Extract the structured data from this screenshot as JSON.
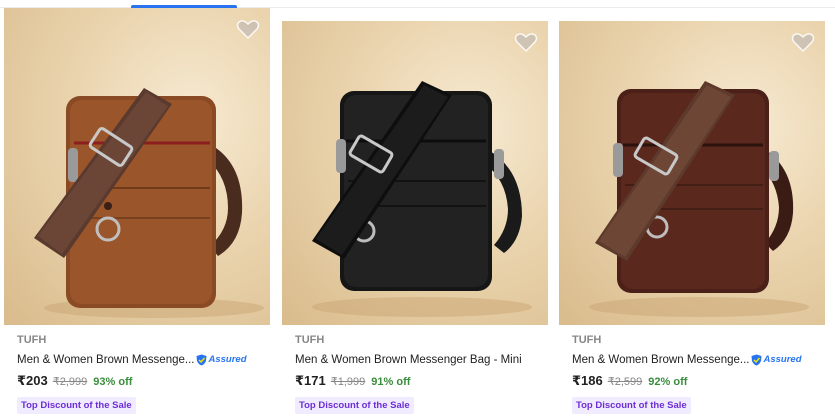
{
  "colors": {
    "accent": "#2874f0",
    "discount": "#388e3c",
    "badge_bg": "#f1ebff",
    "badge_text": "#6c2fd6",
    "muted": "#878787"
  },
  "products": [
    {
      "brand": "TUFH",
      "title": "Men & Women Brown Messenge...",
      "assured": "Assured",
      "price": "₹203",
      "mrp": "₹2,999",
      "discount": "93% off",
      "badge": "Top Discount of the Sale",
      "bag_color": "tan-brown"
    },
    {
      "brand": "TUFH",
      "title": "Men & Women Brown Messenger Bag - Mini",
      "assured": "",
      "price": "₹171",
      "mrp": "₹1,999",
      "discount": "91% off",
      "badge": "Top Discount of the Sale",
      "bag_color": "black"
    },
    {
      "brand": "TUFH",
      "title": "Men & Women Brown Messenge...",
      "assured": "Assured",
      "price": "₹186",
      "mrp": "₹2,599",
      "discount": "92% off",
      "badge": "Top Discount of the Sale",
      "bag_color": "dark-brown"
    }
  ]
}
